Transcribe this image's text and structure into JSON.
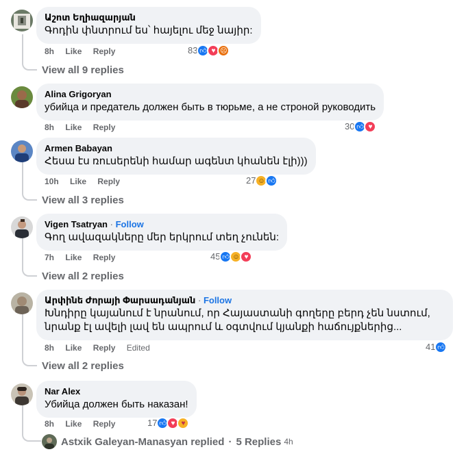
{
  "comments": [
    {
      "author": "Աշոտ Եղիազարյան",
      "text": "Գոդին փնտրում ես՝ հայելու մեջ նայիր:",
      "time": "8h",
      "like": "Like",
      "reply": "Reply",
      "reaction_count": "83",
      "reactions": [
        "like-icon",
        "love-icon",
        "angry-icon"
      ],
      "view_replies": "View all 9 replies"
    },
    {
      "author": "Alina Grigoryan",
      "text": "убийца и предатель должен быть в тюрьме, а не строной руководить",
      "time": "8h",
      "like": "Like",
      "reply": "Reply",
      "reaction_count": "30",
      "reactions": [
        "like-icon",
        "love-icon"
      ]
    },
    {
      "author": "Armen Babayan",
      "text": "Հեսա էս ռուսերենի համար ագենտ կհանեն էլի)))",
      "time": "10h",
      "like": "Like",
      "reply": "Reply",
      "reaction_count": "27",
      "reactions": [
        "haha-icon",
        "like-icon"
      ],
      "view_replies": "View all 3 replies"
    },
    {
      "author": "Vigen Tsatryan",
      "follow": "Follow",
      "text": "Գող ավազակները մեր երկրում տեղ չունեն:",
      "time": "7h",
      "like": "Like",
      "reply": "Reply",
      "reaction_count": "45",
      "reactions": [
        "like-icon",
        "haha-icon",
        "love-icon"
      ],
      "view_replies": "View all 2 replies"
    },
    {
      "author": "Արփինե Ժորայի Փարսադանյան",
      "follow": "Follow",
      "text": "Խնդիրը կայանում է նրանում, որ Հայաստանի գողերը բերդ չեն նստում, նրանք էլ ավելի լավ են ապրում և օգտվում կյանքի հաճույքներից...",
      "time": "8h",
      "like": "Like",
      "reply": "Reply",
      "edited": "Edited",
      "reaction_count": "41",
      "reactions": [
        "like-icon"
      ],
      "view_replies": "View all 2 replies"
    },
    {
      "author": "Nar Alex",
      "text": "Убийца должен быть наказан!",
      "time": "8h",
      "like": "Like",
      "reply": "Reply",
      "reaction_count": "17",
      "reactions": [
        "like-icon",
        "love-icon",
        "care-icon"
      ]
    }
  ],
  "reply_summary": {
    "author": "Astxik Galeyan-Manasyan replied",
    "separator": "·",
    "count": "5 Replies",
    "age": "4h"
  },
  "colors": {
    "bubble": "#f0f2f5",
    "secondary_text": "#65676b",
    "follow": "#1b74e4",
    "like": "#1877f2",
    "love": "#f33e58",
    "angry": "#e9710f",
    "haha": "#f7b125"
  }
}
